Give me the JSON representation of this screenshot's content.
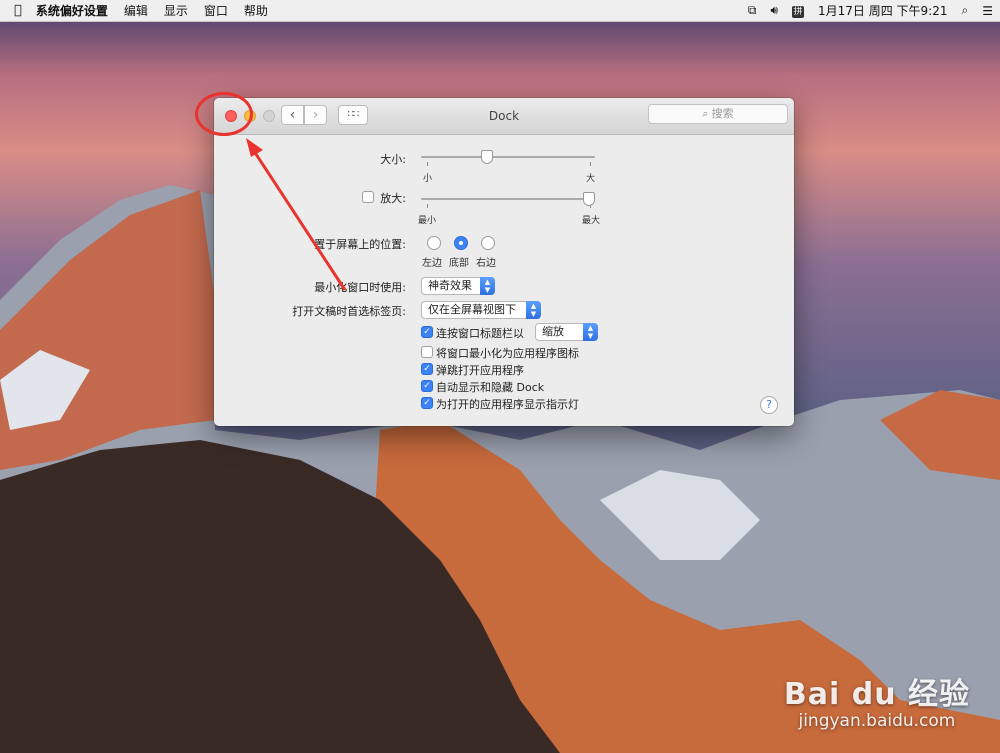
{
  "menubar": {
    "apple": "",
    "app": "系统偏好设置",
    "items": [
      "编辑",
      "显示",
      "窗口",
      "帮助"
    ],
    "status_ime": "拼",
    "clock": "1月17日 周四 下午9:21"
  },
  "window": {
    "title": "Dock",
    "search_placeholder": "搜索"
  },
  "settings": {
    "size_label": "大小:",
    "size_min": "小",
    "size_max": "大",
    "size_value": 0.37,
    "magnify_label": "放大:",
    "magnify_checked": false,
    "magnify_min": "最小",
    "magnify_max": "最大",
    "magnify_value": 1.0,
    "position_label": "置于屏幕上的位置:",
    "positions": [
      {
        "label": "左边",
        "selected": false
      },
      {
        "label": "底部",
        "selected": true
      },
      {
        "label": "右边",
        "selected": false
      }
    ],
    "minimize_label": "最小化窗口时使用:",
    "minimize_value": "神奇效果",
    "tabs_label": "打开文稿时首选标签页:",
    "tabs_value": "仅在全屏幕视图下",
    "checkboxes": [
      {
        "label": "连按窗口标题栏以",
        "checked": true
      },
      {
        "label": "将窗口最小化为应用程序图标",
        "checked": false
      },
      {
        "label": "弹跳打开应用程序",
        "checked": true
      },
      {
        "label": "自动显示和隐藏 Dock",
        "checked": true
      },
      {
        "label": "为打开的应用程序显示指示灯",
        "checked": true
      }
    ],
    "doubleclick_value": "缩放",
    "help": "?"
  },
  "watermark": {
    "brand": "Bai du 经验",
    "url": "jingyan.baidu.com"
  },
  "colors": {
    "accent": "#3b83f6",
    "annotation": "#e8332e"
  }
}
